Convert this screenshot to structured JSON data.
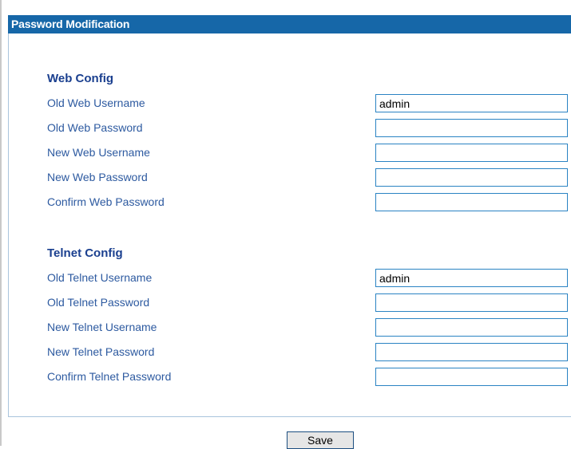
{
  "header": {
    "title": "Password Modification"
  },
  "web_config": {
    "title": "Web Config",
    "rows": [
      {
        "label": "Old Web Username",
        "value": "admin"
      },
      {
        "label": "Old Web Password",
        "value": ""
      },
      {
        "label": "New Web Username",
        "value": ""
      },
      {
        "label": "New Web Password",
        "value": ""
      },
      {
        "label": "Confirm Web Password",
        "value": ""
      }
    ]
  },
  "telnet_config": {
    "title": "Telnet Config",
    "rows": [
      {
        "label": "Old Telnet Username",
        "value": "admin"
      },
      {
        "label": "Old Telnet Password",
        "value": ""
      },
      {
        "label": "New Telnet Username",
        "value": ""
      },
      {
        "label": "New Telnet Password",
        "value": ""
      },
      {
        "label": "Confirm Telnet Password",
        "value": ""
      }
    ]
  },
  "actions": {
    "save_label": "Save"
  },
  "colors": {
    "header_bg": "#1667a8",
    "label": "#2d5aa0",
    "section_title": "#1a3f8f",
    "field_border": "#2a83c3"
  }
}
